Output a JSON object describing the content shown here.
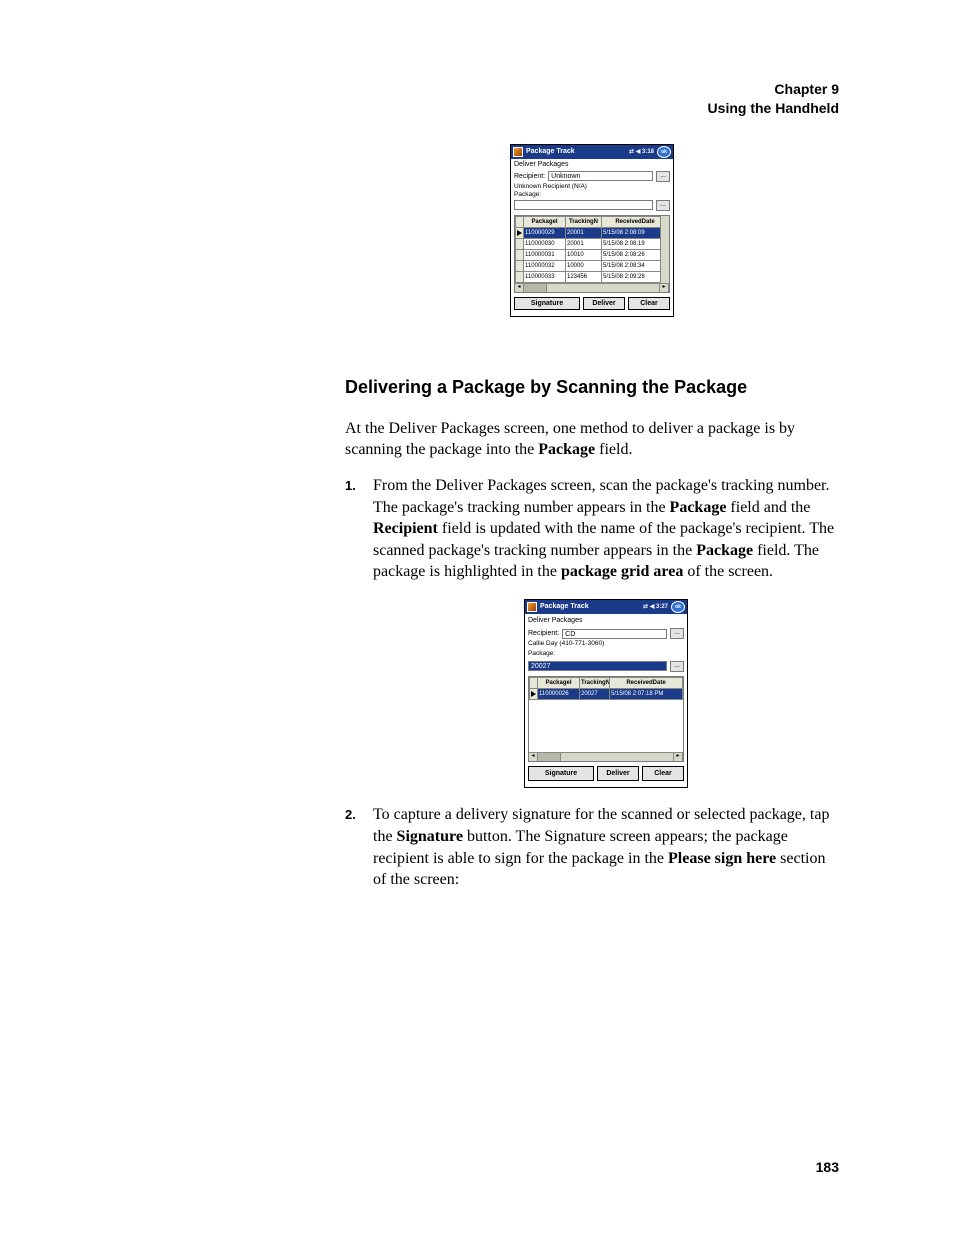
{
  "header": {
    "chapter": "Chapter 9",
    "title": "Using the Handheld"
  },
  "section_title": "Delivering a Package by Scanning the Package",
  "intro": {
    "pre": "At the Deliver Packages screen, one method to deliver a package is by scanning the package into the ",
    "bold": "Package",
    "post": " field."
  },
  "step1": {
    "num": "1.",
    "t1": "From the Deliver Packages screen, scan the package's tracking number. The package's tracking number appears in the ",
    "b1": "Package",
    "t2": " field and the ",
    "b2": "Recipient",
    "t3": " field is updated with the name of the package's recipient. The scanned package's tracking number appears in the ",
    "b3": "Package",
    "t4": " field. The package is highlighted in the ",
    "b4": "package grid area",
    "t5": " of the screen."
  },
  "step2": {
    "num": "2.",
    "t1": "To capture a delivery signature for the scanned or selected package, tap the ",
    "b1": "Signature",
    "t2": " button. The Signature screen appears; the package recipient is able to sign for the package in the ",
    "b2": "Please sign here",
    "t3": " section of the screen:"
  },
  "page_number": "183",
  "shot1": {
    "app_title": "Package Track",
    "sys_icons": "⇄ ◀ 3:18",
    "ok": "ok",
    "screen": "Deliver Packages",
    "recipient_label": "Recipient:",
    "recipient_value": "Unknown",
    "recipient_sub": "Unknown Recipient (N/A)",
    "package_label": "Package:",
    "cols": [
      "PackageI",
      "TrackingN",
      "ReceivedDate"
    ],
    "rows": [
      {
        "sel": true,
        "id": "110000029",
        "trk": "20001",
        "date": "5/15/08 2:08:09"
      },
      {
        "id": "110000030",
        "trk": "20001",
        "date": "5/15/08 2:08:19"
      },
      {
        "id": "110000031",
        "trk": "10010",
        "date": "5/15/08 2:08:26"
      },
      {
        "id": "110000032",
        "trk": "10000",
        "date": "5/15/08 2:08:34"
      },
      {
        "id": "110000033",
        "trk": "123456",
        "date": "5/15/08 2:09:28"
      }
    ],
    "btn_sig": "Signature",
    "btn_deliver": "Deliver",
    "btn_clear": "Clear"
  },
  "shot2": {
    "app_title": "Package Track",
    "sys_icons": "⇄ ◀ 3:27",
    "ok": "ok",
    "screen": "Deliver Packages",
    "recipient_label": "Recipient:",
    "recipient_value": "CD",
    "recipient_sub": "Callie Day (410-771-3060)",
    "package_label": "Package:",
    "package_value": "20027",
    "cols": [
      "PackageI",
      "TrackingN",
      "ReceivedDate"
    ],
    "rows": [
      {
        "sel": true,
        "id": "110000026",
        "trk": "20027",
        "date": "5/15/08 2:07:18 PM"
      }
    ],
    "btn_sig": "Signature",
    "btn_deliver": "Deliver",
    "btn_clear": "Clear"
  }
}
